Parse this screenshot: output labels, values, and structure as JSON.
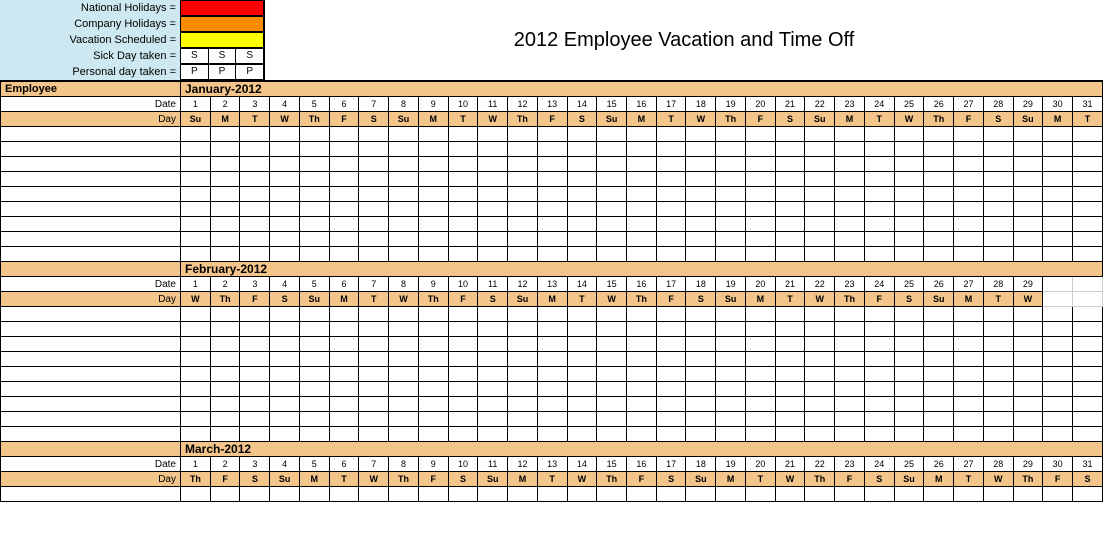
{
  "title": "2012 Employee Vacation and Time Off",
  "legend": {
    "national": "National Holidays =",
    "company": "Company Holidays =",
    "vacation": "Vacation Scheduled =",
    "sick": "Sick Day taken =",
    "sick_code": "S",
    "personal": "Personal day taken =",
    "personal_code": "P"
  },
  "labels": {
    "employee": "Employee",
    "date": "Date",
    "day": "Day"
  },
  "months": [
    {
      "name": "January-2012",
      "num_days": 31,
      "dates": [
        "1",
        "2",
        "3",
        "4",
        "5",
        "6",
        "7",
        "8",
        "9",
        "10",
        "11",
        "12",
        "13",
        "14",
        "15",
        "16",
        "17",
        "18",
        "19",
        "20",
        "21",
        "22",
        "23",
        "24",
        "25",
        "26",
        "27",
        "28",
        "29",
        "30",
        "31"
      ],
      "days": [
        "Su",
        "M",
        "T",
        "W",
        "Th",
        "F",
        "S",
        "Su",
        "M",
        "T",
        "W",
        "Th",
        "F",
        "S",
        "Su",
        "M",
        "T",
        "W",
        "Th",
        "F",
        "S",
        "Su",
        "M",
        "T",
        "W",
        "Th",
        "F",
        "S",
        "Su",
        "M",
        "T"
      ],
      "data_rows": 9
    },
    {
      "name": "February-2012",
      "num_days": 29,
      "dates": [
        "1",
        "2",
        "3",
        "4",
        "5",
        "6",
        "7",
        "8",
        "9",
        "10",
        "11",
        "12",
        "13",
        "14",
        "15",
        "16",
        "17",
        "18",
        "19",
        "20",
        "21",
        "22",
        "23",
        "24",
        "25",
        "26",
        "27",
        "28",
        "29"
      ],
      "days": [
        "W",
        "Th",
        "F",
        "S",
        "Su",
        "M",
        "T",
        "W",
        "Th",
        "F",
        "S",
        "Su",
        "M",
        "T",
        "W",
        "Th",
        "F",
        "S",
        "Su",
        "M",
        "T",
        "W",
        "Th",
        "F",
        "S",
        "Su",
        "M",
        "T",
        "W"
      ],
      "data_rows": 9
    },
    {
      "name": "March-2012",
      "num_days": 31,
      "dates": [
        "1",
        "2",
        "3",
        "4",
        "5",
        "6",
        "7",
        "8",
        "9",
        "10",
        "11",
        "12",
        "13",
        "14",
        "15",
        "16",
        "17",
        "18",
        "19",
        "20",
        "21",
        "22",
        "23",
        "24",
        "25",
        "26",
        "27",
        "28",
        "29",
        "30",
        "31"
      ],
      "days": [
        "Th",
        "F",
        "S",
        "Su",
        "M",
        "T",
        "W",
        "Th",
        "F",
        "S",
        "Su",
        "M",
        "T",
        "W",
        "Th",
        "F",
        "S",
        "Su",
        "M",
        "T",
        "W",
        "Th",
        "F",
        "S",
        "Su",
        "M",
        "T",
        "W",
        "Th",
        "F",
        "S"
      ],
      "data_rows": 1
    }
  ],
  "max_days": 31
}
